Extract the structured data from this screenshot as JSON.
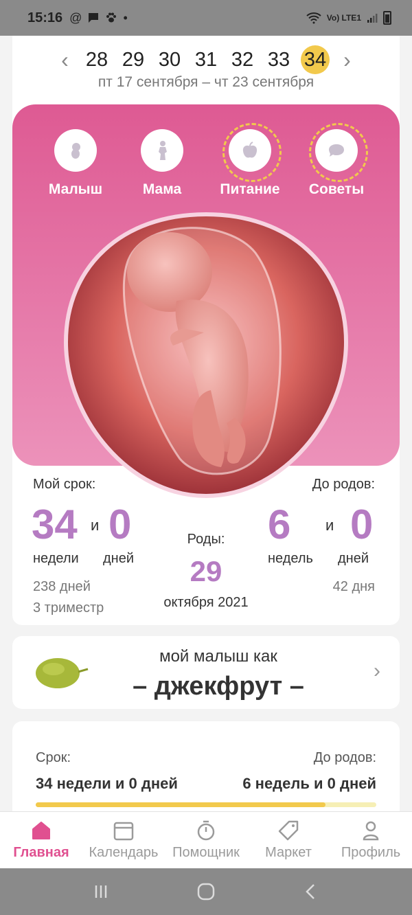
{
  "status_bar": {
    "time": "15:16",
    "network": "Vo) LTE1"
  },
  "weeks": {
    "items": [
      "28",
      "29",
      "30",
      "31",
      "32",
      "33",
      "34"
    ],
    "active": "34",
    "date_range": "пт 17 сентября – чт 23 сентября"
  },
  "categories": [
    {
      "label": "Малыш",
      "icon": "baby-icon"
    },
    {
      "label": "Мама",
      "icon": "mother-icon"
    },
    {
      "label": "Питание",
      "icon": "apple-icon"
    },
    {
      "label": "Советы",
      "icon": "chat-bubble-icon"
    }
  ],
  "term": {
    "label": "Мой срок:",
    "weeks": "34",
    "and": "и",
    "days": "0",
    "weeks_unit": "недели",
    "days_unit": "дней",
    "total_days": "238 дней",
    "trimester": "3 триместр"
  },
  "birth": {
    "label": "Роды:",
    "day": "29",
    "month_year": "октября 2021"
  },
  "remaining": {
    "label": "До родов:",
    "weeks": "6",
    "and": "и",
    "days": "0",
    "weeks_unit": "недель",
    "days_unit": "дней",
    "total_days": "42 дня"
  },
  "fruit": {
    "prefix": "мой малыш как",
    "name": "– джекфрут –"
  },
  "progress": {
    "term_label": "Срок:",
    "term_value": "34 недели и 0 дней",
    "remaining_label": "До родов:",
    "remaining_value": "6 недель и 0 дней",
    "fraction": 0.85
  },
  "bottom_nav": [
    {
      "label": "Главная",
      "icon": "home-icon",
      "active": true
    },
    {
      "label": "Календарь",
      "icon": "calendar-icon",
      "active": false
    },
    {
      "label": "Помощник",
      "icon": "timer-icon",
      "active": false
    },
    {
      "label": "Маркет",
      "icon": "tag-icon",
      "active": false
    },
    {
      "label": "Профиль",
      "icon": "profile-icon",
      "active": false
    }
  ],
  "colors": {
    "accent_pink": "#e05090",
    "highlight_yellow": "#f2c94c",
    "number_purple": "#b57bc2"
  }
}
